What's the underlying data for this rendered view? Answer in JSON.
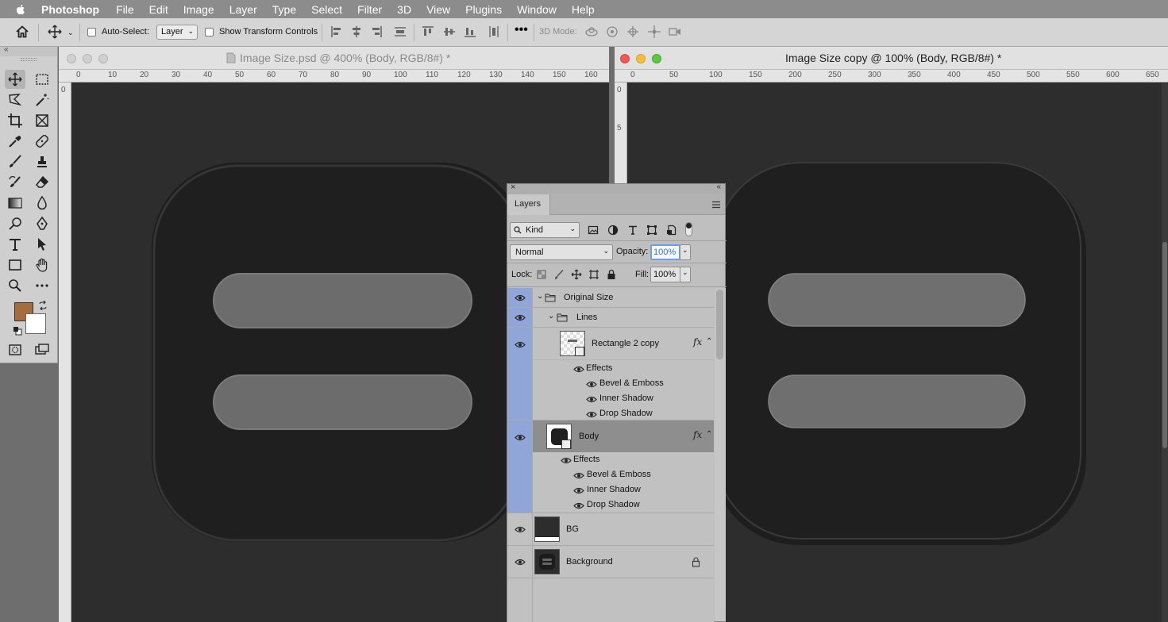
{
  "menubar": {
    "app": "Photoshop",
    "items": [
      "File",
      "Edit",
      "Image",
      "Layer",
      "Type",
      "Select",
      "Filter",
      "3D",
      "View",
      "Plugins",
      "Window",
      "Help"
    ]
  },
  "options": {
    "auto_select_label": "Auto-Select:",
    "auto_select_value": "Layer",
    "transform_label": "Show Transform Controls",
    "mode3d_label": "3D Mode:"
  },
  "colors": {
    "foreground": "#a76c3d",
    "background": "#ffffff"
  },
  "doc1": {
    "title": "Image Size.psd @ 400% (Body, RGB/8#) *",
    "ruler_h": [
      "0",
      "10",
      "20",
      "30",
      "40",
      "50",
      "60",
      "70",
      "80",
      "90",
      "100",
      "110",
      "120",
      "130",
      "140",
      "150",
      "160"
    ],
    "ruler_v": [
      "0"
    ]
  },
  "doc2": {
    "title": "Image Size copy @ 100% (Body, RGB/8#) *",
    "ruler_h": [
      "0",
      "50",
      "100",
      "150",
      "200",
      "250",
      "300",
      "350",
      "400",
      "450",
      "500",
      "550",
      "600",
      "650"
    ],
    "ruler_v": [
      "0",
      "5"
    ]
  },
  "layers_panel": {
    "tab": "Layers",
    "filter_kind": "Kind",
    "blend_mode": "Normal",
    "opacity_label": "Opacity:",
    "opacity_value": "100%",
    "lock_label": "Lock:",
    "fill_label": "Fill:",
    "fill_value": "100%",
    "layers": {
      "original_size": "Original Size",
      "lines": "Lines",
      "rect2copy": "Rectangle 2 copy",
      "effects1": "Effects",
      "bevel1": "Bevel & Emboss",
      "inner1": "Inner Shadow",
      "drop1": "Drop Shadow",
      "body": "Body",
      "effects2": "Effects",
      "bevel2": "Bevel & Emboss",
      "inner2": "Inner Shadow",
      "drop2": "Drop Shadow",
      "bg": "BG",
      "background": "Background"
    }
  }
}
